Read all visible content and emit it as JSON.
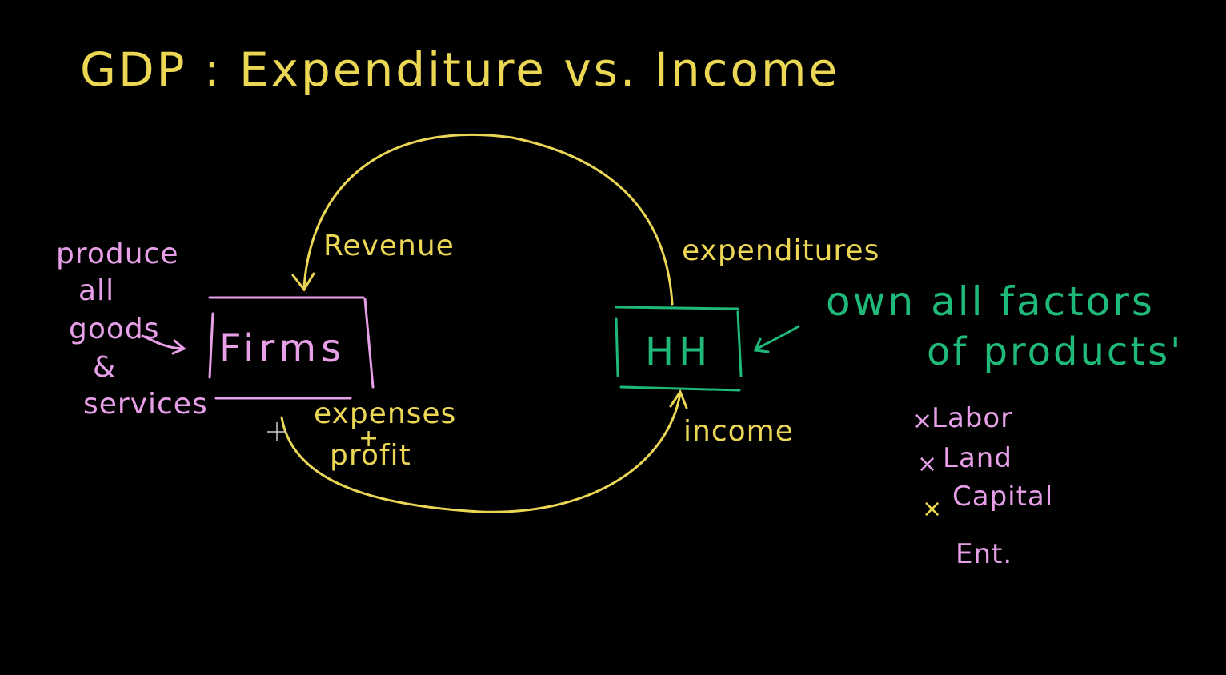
{
  "title": "GDP : Expenditure vs. Income",
  "colors": {
    "background": "#000000",
    "yellow": "#ecd755",
    "pink": "#e79fe8",
    "green": "#1fb97a"
  },
  "nodes": {
    "firms": "Firms",
    "households": "HH"
  },
  "flows": {
    "revenue": "Revenue",
    "expenditures": "expenditures",
    "income": "income",
    "expenses": "expenses",
    "plus": "+",
    "profit": "profit"
  },
  "firms_note": [
    "produce",
    "all",
    "goods",
    "&",
    "services"
  ],
  "hh_note": [
    "own all factors",
    "of products'"
  ],
  "factors": [
    {
      "bullet": "×",
      "label": "Labor"
    },
    {
      "bullet": "×",
      "label": "Land"
    },
    {
      "bullet": "×",
      "label": "Capital"
    },
    {
      "bullet": "",
      "label": "Ent."
    }
  ]
}
